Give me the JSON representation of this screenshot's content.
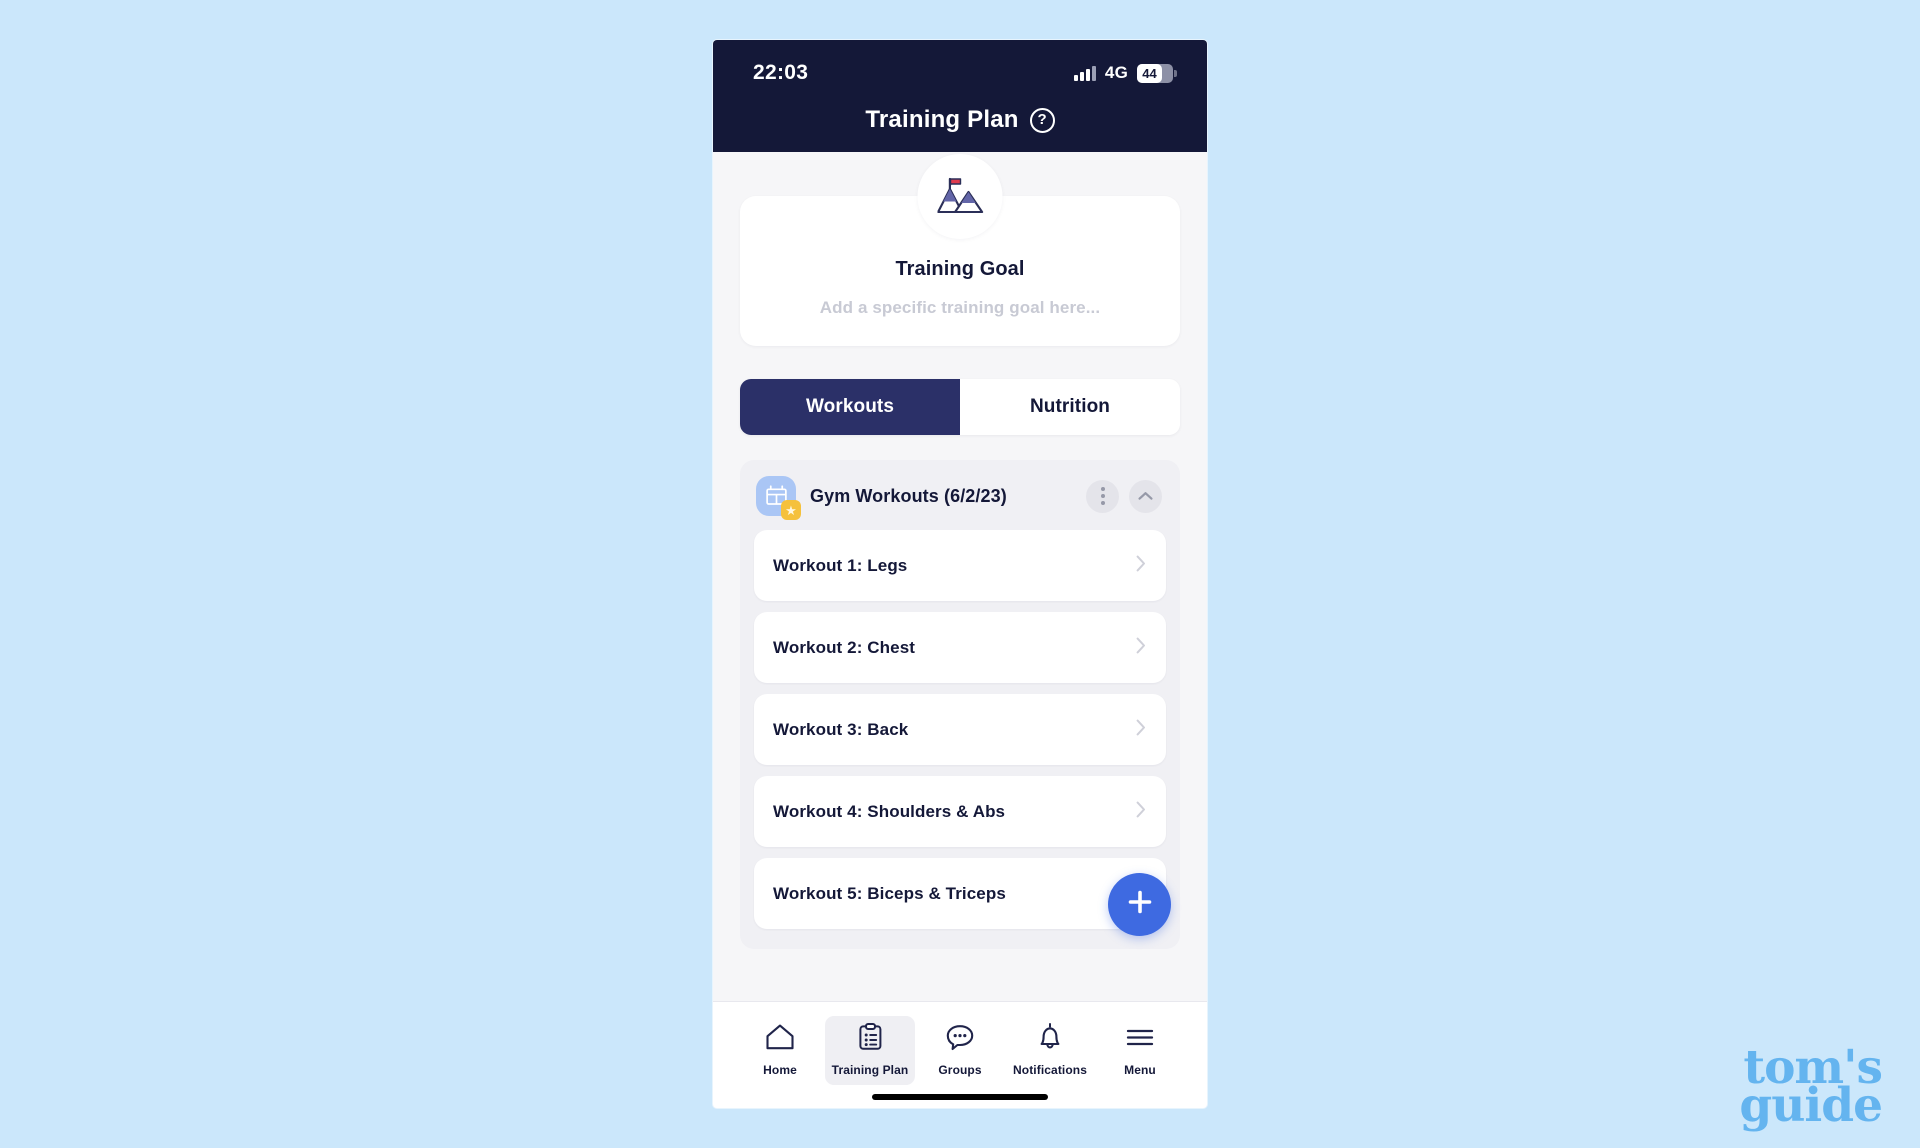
{
  "colors": {
    "page_background": "#cbe7fb",
    "header_navy": "#141838",
    "tab_active": "#2b3068",
    "fab_blue": "#3e6ae1",
    "group_icon_blue": "#aac6f5",
    "badge_yellow": "#f5c13c",
    "watermark_blue": "#64b4ef",
    "card_white": "#ffffff",
    "screen_grey": "#f6f6f8"
  },
  "status_bar": {
    "time": "22:03",
    "network": "4G",
    "battery_level": "44",
    "signal_icon": "signal-bars-icon",
    "battery_icon": "battery-icon"
  },
  "header": {
    "title": "Training Plan",
    "help_label": "?",
    "help_icon": "help-circle-icon"
  },
  "goal_card": {
    "avatar_icon": "mountain-flag-icon",
    "title": "Training Goal",
    "placeholder": "Add a specific training goal here..."
  },
  "tabs": [
    {
      "label": "Workouts",
      "active": true
    },
    {
      "label": "Nutrition",
      "active": false
    }
  ],
  "workout_group": {
    "icon": "gym-rack-icon",
    "badge_icon": "star-badge-icon",
    "title": "Gym Workouts (6/2/23)",
    "menu_icon": "more-vertical-icon",
    "collapse_icon": "chevron-up-icon",
    "rows": [
      {
        "label": "Workout 1: Legs",
        "chevron": "chevron-right-icon"
      },
      {
        "label": "Workout 2: Chest",
        "chevron": "chevron-right-icon"
      },
      {
        "label": "Workout 3: Back",
        "chevron": "chevron-right-icon"
      },
      {
        "label": "Workout 4: Shoulders & Abs",
        "chevron": "chevron-right-icon"
      },
      {
        "label": "Workout 5: Biceps & Triceps",
        "chevron": "chevron-right-icon"
      }
    ]
  },
  "fab": {
    "icon": "plus-icon",
    "label": "+"
  },
  "bottom_nav": [
    {
      "label": "Home",
      "icon": "home-icon",
      "active": false
    },
    {
      "label": "Training Plan",
      "icon": "clipboard-icon",
      "active": true
    },
    {
      "label": "Groups",
      "icon": "chat-bubble-icon",
      "active": false
    },
    {
      "label": "Notifications",
      "icon": "bell-icon",
      "active": false
    },
    {
      "label": "Menu",
      "icon": "hamburger-menu-icon",
      "active": false
    }
  ],
  "watermark": {
    "line1": "tom's",
    "line2": "guide"
  }
}
